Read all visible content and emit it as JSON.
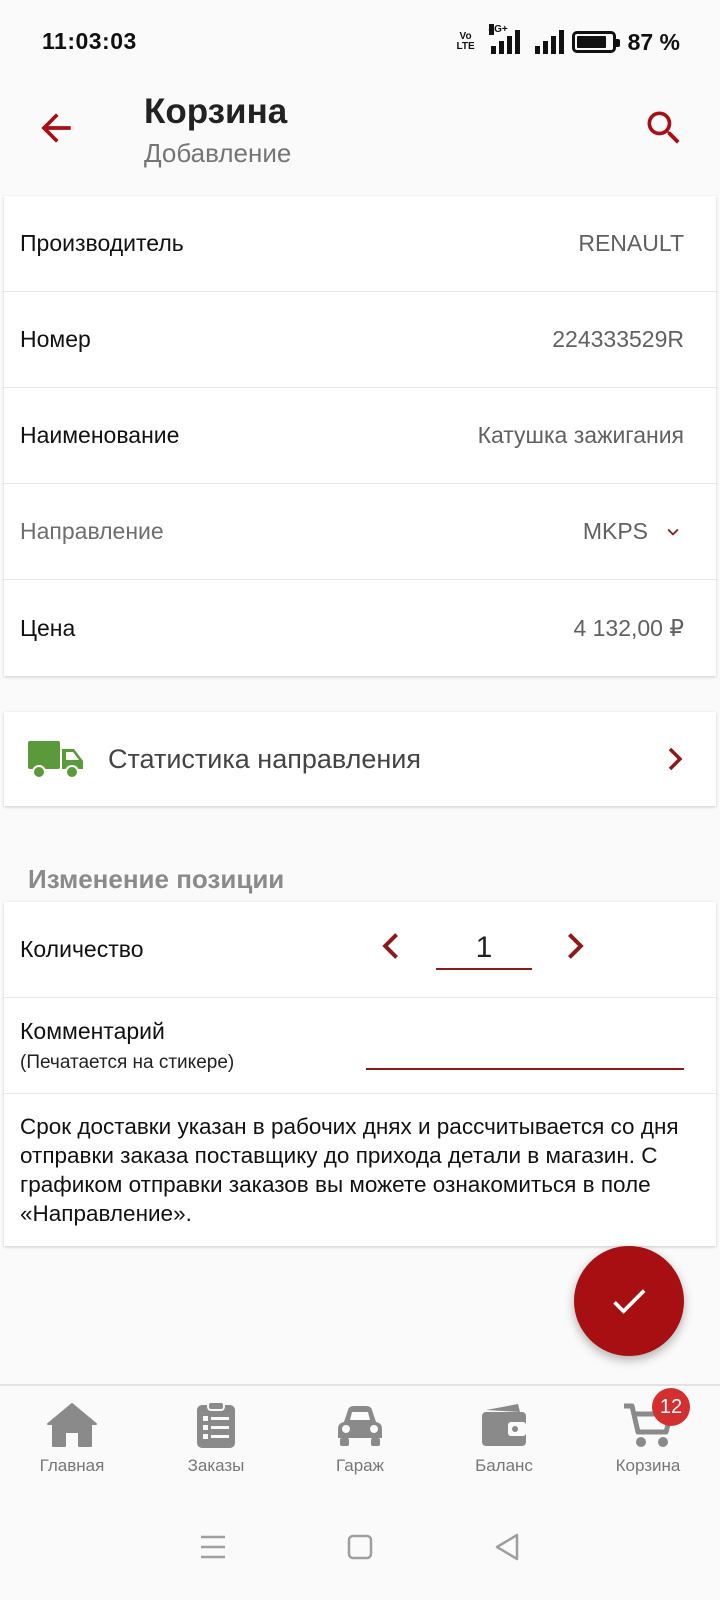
{
  "status_bar": {
    "time": "11:03:03",
    "volte_line1": "Vo",
    "volte_line2": "LTE",
    "network": "4G+",
    "battery_percent": 87,
    "battery_text": "87 %"
  },
  "app_bar": {
    "title": "Корзина",
    "subtitle": "Добавление",
    "back_icon": "arrow-left-icon",
    "search_icon": "search-icon",
    "accent_color": "#a70f12"
  },
  "details": {
    "rows": [
      {
        "label": "Производитель",
        "value": "RENAULT"
      },
      {
        "label": "Номер",
        "value": "224333529R"
      },
      {
        "label": "Наименование",
        "value": "Катушка зажигания"
      },
      {
        "label": "Направление",
        "value": "MKPS"
      },
      {
        "label": "Цена",
        "value": "4 132,00 ₽"
      }
    ]
  },
  "stats": {
    "label": "Статистика направления",
    "icon": "truck-icon",
    "icon_color": "#5a9a3a"
  },
  "edit_section": {
    "title": "Изменение позиции",
    "quantity_label": "Количество",
    "quantity_value": "1",
    "comment_label": "Комментарий",
    "comment_hint": "(Печатается на стикере)",
    "comment_value": "",
    "notice": "Срок доставки указан в рабочих днях и рассчитывается со дня отправки заказа поставщику до прихода детали в магазин. С графиком отправки заказов вы можете ознакомиться в поле «Направление»."
  },
  "fab": {
    "icon": "check-icon"
  },
  "bottom_nav": {
    "items": [
      {
        "label": "Главная",
        "icon": "home-icon"
      },
      {
        "label": "Заказы",
        "icon": "orders-icon"
      },
      {
        "label": "Гараж",
        "icon": "car-icon"
      },
      {
        "label": "Баланс",
        "icon": "wallet-icon"
      },
      {
        "label": "Корзина",
        "icon": "cart-icon",
        "badge": "12"
      }
    ]
  },
  "system_nav": {
    "items": [
      "menu-icon",
      "home-square-icon",
      "back-triangle-icon"
    ]
  }
}
